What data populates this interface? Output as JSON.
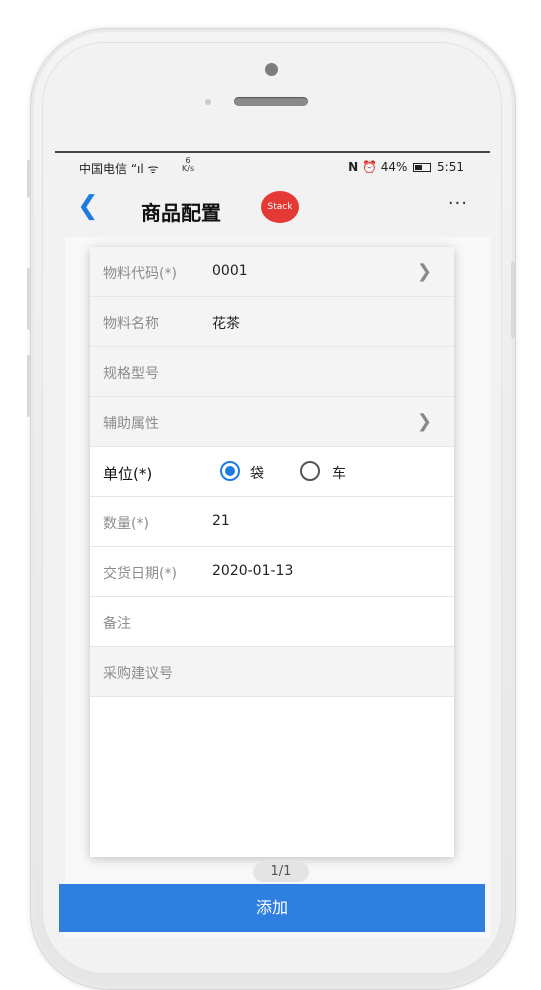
{
  "status_bar": {
    "carrier": "中国电信",
    "net_speed_value": "6",
    "net_speed_unit": "K/s",
    "battery": "44%",
    "time": "5:51"
  },
  "navbar": {
    "back_icon": "chevron-left-icon",
    "title": "商品配置",
    "badge": "Stack",
    "more_icon": "more-horizontal-icon",
    "more_label": "···"
  },
  "form": {
    "material_code": {
      "label": "物料代码(*)",
      "value": "0001"
    },
    "material_name": {
      "label": "物料名称",
      "value": "花茶"
    },
    "spec_model": {
      "label": "规格型号",
      "value": ""
    },
    "aux_attr": {
      "label": "辅助属性",
      "value": ""
    },
    "unit": {
      "label": "单位(*)",
      "options": [
        "袋",
        "车"
      ],
      "selected": "袋"
    },
    "quantity": {
      "label": "数量(*)",
      "value": "21"
    },
    "delivery_date": {
      "label": "交货日期(*)",
      "value": "2020-01-13"
    },
    "remark": {
      "label": "备注",
      "value": ""
    },
    "purchase_suggestion": {
      "label": "采购建议号",
      "value": ""
    }
  },
  "pager": "1/1",
  "add_button": "添加",
  "colors": {
    "accent": "#2f7fe0",
    "badge": "#e53935"
  }
}
